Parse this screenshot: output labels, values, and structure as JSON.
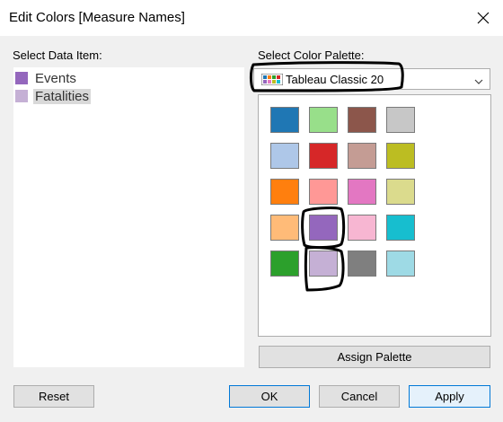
{
  "window": {
    "title": "Edit Colors [Measure Names]",
    "close_icon": "close-icon"
  },
  "left": {
    "label": "Select Data Item:",
    "items": [
      {
        "label": "Events",
        "color": "#9467bd",
        "selected": false
      },
      {
        "label": "Fatalities",
        "color": "#c5b0d5",
        "selected": true
      }
    ]
  },
  "right": {
    "label": "Select Color Palette:",
    "palette": {
      "selected": "Tableau Classic 20",
      "icon": "palette-icon"
    },
    "swatches": [
      "#1f77b4",
      "#98df8a",
      "#8c564b",
      "#c7c7c7",
      "#aec7e8",
      "#d62728",
      "#c49c94",
      "#bcbd22",
      "#ff7f0e",
      "#ff9896",
      "#e377c2",
      "#dbdb8d",
      "#ffbb78",
      "#9467bd",
      "#f7b6d2",
      "#17becf",
      "#2ca02c",
      "#c5b0d5",
      "#7f7f7f",
      "#9edae5"
    ],
    "assign_label": "Assign Palette"
  },
  "buttons": {
    "reset": "Reset",
    "ok": "OK",
    "cancel": "Cancel",
    "apply": "Apply"
  },
  "colors": {
    "accent": "#0078d7",
    "annotation": "#000000"
  }
}
